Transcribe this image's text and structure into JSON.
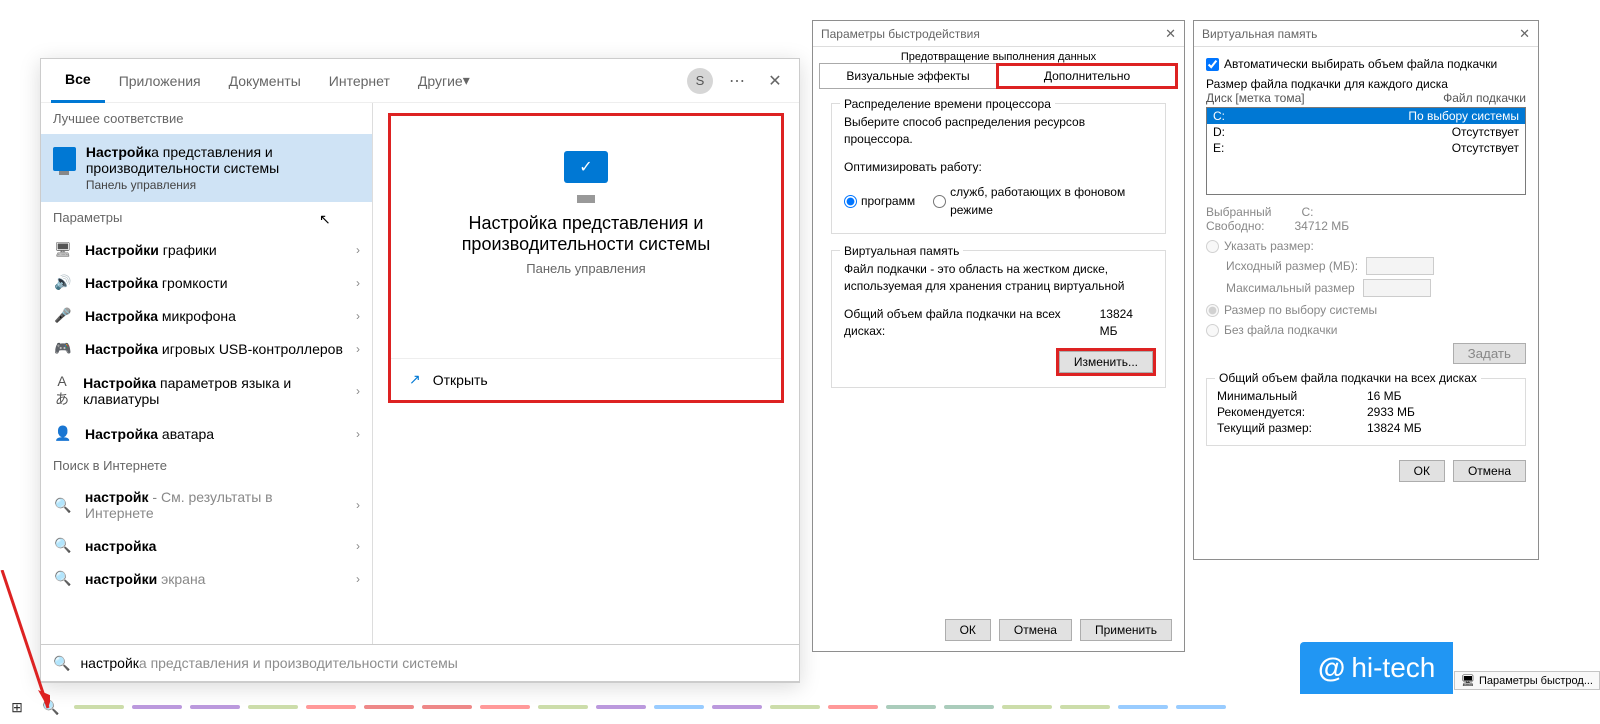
{
  "search": {
    "tabs": {
      "all": "Все",
      "apps": "Приложения",
      "docs": "Документы",
      "web": "Интернет",
      "more": "Другие"
    },
    "avatar_letter": "S",
    "best_head": "Лучшее соответствие",
    "best_title": "Настройка представления и производительности системы",
    "best_bold": "Настройк",
    "best_sub": "Панель управления",
    "params_head": "Параметры",
    "items": [
      {
        "icon": "🖥",
        "bold": "Настройки",
        "rest": " графики"
      },
      {
        "icon": "🔊",
        "bold": "Настройка",
        "rest": " громкости"
      },
      {
        "icon": "🎤",
        "bold": "Настройка",
        "rest": " микрофона"
      },
      {
        "icon": "🎮",
        "bold": "Настройка",
        "rest": " игровых USB-контроллеров"
      },
      {
        "icon": "Aあ",
        "bold": "Настройка",
        "rest": " параметров языка и клавиатуры"
      },
      {
        "icon": "👤",
        "bold": "Настройка",
        "rest": " аватара"
      }
    ],
    "net_head": "Поиск в Интернете",
    "net_items": [
      {
        "bold": "настройк",
        "rest": " - См. результаты в Интернете"
      },
      {
        "bold": "настройка",
        "rest": ""
      },
      {
        "bold": "настройки",
        "rest": " экрана"
      }
    ],
    "preview_title": "Настройка представления и производительности системы",
    "preview_sub": "Панель управления",
    "open_label": "Открыть",
    "typed": "настройк",
    "suggest": "а представления и производительности системы"
  },
  "perf": {
    "title": "Параметры быстродействия",
    "subhead": "Предотвращение выполнения данных",
    "tab_visual": "Визуальные эффекты",
    "tab_adv": "Дополнительно",
    "cpu_group": "Распределение времени процессора",
    "cpu_desc": "Выберите способ распределения ресурсов процессора.",
    "cpu_opt_label": "Оптимизировать работу:",
    "cpu_opt_prog": "программ",
    "cpu_opt_bg": "служб, работающих в фоновом режиме",
    "vmem_group": "Виртуальная память",
    "vmem_desc": "Файл подкачки - это область на жестком диске, используемая для хранения страниц виртуальной",
    "total_label": "Общий объем файла подкачки на всех дисках:",
    "total_value": "13824 МБ",
    "change": "Изменить...",
    "ok": "ОК",
    "cancel": "Отмена",
    "apply": "Применить"
  },
  "vmem": {
    "title": "Виртуальная память",
    "auto": "Автоматически выбирать объем файла подкачки",
    "list_head": "Размер файла подкачки для каждого диска",
    "col_drive": "Диск [метка тома]",
    "col_file": "Файл подкачки",
    "rows": [
      {
        "d": "C:",
        "v": "По выбору системы",
        "sel": true
      },
      {
        "d": "D:",
        "v": "Отсутствует"
      },
      {
        "d": "E:",
        "v": "Отсутствует"
      }
    ],
    "selected_label": "Выбранный",
    "selected_value": "C:",
    "free_label": "Свободно:",
    "free_value": "34712 МБ",
    "opt_custom": "Указать размер:",
    "init_label": "Исходный размер (МБ):",
    "max_label": "Максимальный размер",
    "opt_system": "Размер по выбору системы",
    "opt_none": "Без файла подкачки",
    "set": "Задать",
    "total_group": "Общий объем файла подкачки на всех дисках",
    "min_l": "Минимальный",
    "min_v": "16 МБ",
    "rec_l": "Рекомендуется:",
    "rec_v": "2933 МБ",
    "cur_l": "Текущий размер:",
    "cur_v": "13824 МБ",
    "ok": "ОК",
    "cancel": "Отмена"
  },
  "taskbar": {
    "notif": "Параметры быстрод..."
  },
  "brand": "hi-tech",
  "stripe_colors": [
    "#cda",
    "#b9d",
    "#b9d",
    "#cda",
    "#f99",
    "#e88",
    "#e88",
    "#f99",
    "#cda",
    "#b9d",
    "#9cf",
    "#b9d",
    "#cda",
    "#f99",
    "#acb",
    "#acb",
    "#cda",
    "#cda",
    "#9cf",
    "#9cf"
  ]
}
